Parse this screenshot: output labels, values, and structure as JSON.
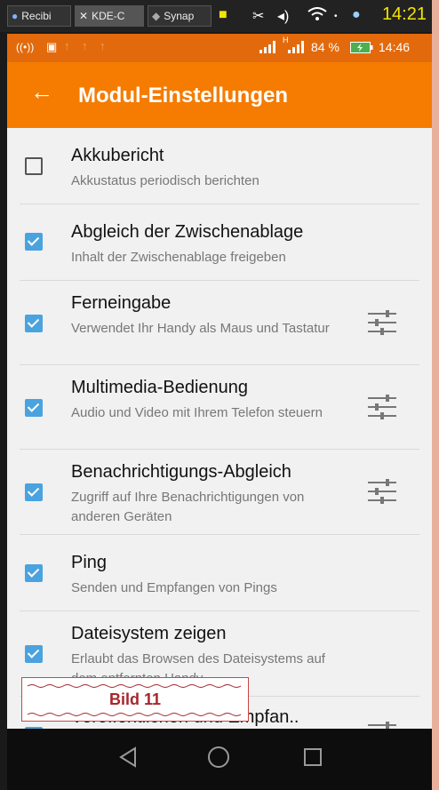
{
  "desktop": {
    "tasks": [
      "Recibi",
      "KDE-C",
      "Synap"
    ],
    "clock": "14:21"
  },
  "status": {
    "battery": "84 %",
    "network": "H",
    "time": "14:46"
  },
  "toolbar": {
    "title": "Modul-Einstellungen"
  },
  "items": [
    {
      "title": "Akkubericht",
      "desc": "Akkustatus periodisch berichten",
      "checked": false,
      "settings": false
    },
    {
      "title": "Abgleich der Zwischenablage",
      "desc": "Inhalt der Zwischenablage freigeben",
      "checked": true,
      "settings": false
    },
    {
      "title": "Ferneingabe",
      "desc": "Verwendet Ihr Handy als Maus und Tastatur",
      "checked": true,
      "settings": true
    },
    {
      "title": "Multimedia-Bedienung",
      "desc": "Audio und Video mit Ihrem Telefon steuern",
      "checked": true,
      "settings": true
    },
    {
      "title": "Benachrichtigungs-Abgleich",
      "desc": "Zugriff auf Ihre Benachrichtigungen von anderen Geräten",
      "checked": true,
      "settings": true
    },
    {
      "title": "Ping",
      "desc": "Senden und Empfangen von Pings",
      "checked": true,
      "settings": false
    },
    {
      "title": "Dateisystem zeigen",
      "desc": "Erlaubt das Browsen des Dateisystems auf dem entfernten Handy",
      "checked": true,
      "settings": false
    },
    {
      "title": "Veröffentlichen und Empfan..",
      "desc": "",
      "checked": true,
      "settings": true
    }
  ],
  "caption": "Bild 11",
  "colors": {
    "accent": "#f57c00",
    "check": "#4aa3df",
    "captionText": "#a6262b"
  }
}
